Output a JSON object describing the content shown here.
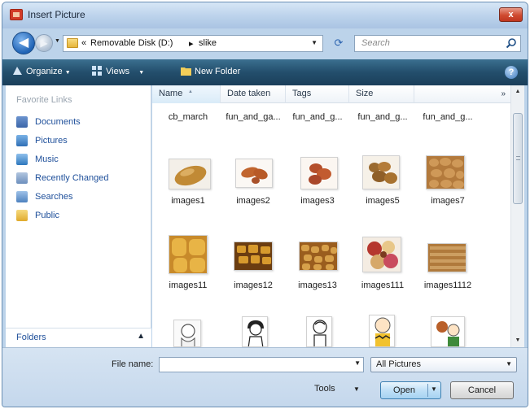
{
  "window": {
    "title": "Insert Picture",
    "close_label": "x"
  },
  "nav": {
    "back_glyph": "◀",
    "forward_glyph": "▶"
  },
  "address": {
    "prefix": "«",
    "crumbs": [
      "Removable Disk (D:)",
      "slike"
    ],
    "separator": "▸"
  },
  "search": {
    "placeholder": "Search"
  },
  "toolbar": {
    "organize": "Organize",
    "views": "Views",
    "new_folder": "New Folder",
    "help": "?"
  },
  "favorites": {
    "heading": "Favorite Links",
    "items": [
      {
        "label": "Documents",
        "icon": "documents-icon",
        "color": "#4b76b8"
      },
      {
        "label": "Pictures",
        "icon": "pictures-icon",
        "color": "#3f7fc4"
      },
      {
        "label": "Music",
        "icon": "music-icon",
        "color": "#3b86c8"
      },
      {
        "label": "Recently Changed",
        "icon": "recently-changed-icon",
        "color": "#6d8fbd"
      },
      {
        "label": "Searches",
        "icon": "searches-icon",
        "color": "#5e8fc6"
      },
      {
        "label": "Public",
        "icon": "public-icon",
        "color": "#e4b53a"
      }
    ]
  },
  "folders": {
    "label": "Folders",
    "chevron": "▲"
  },
  "columns": [
    {
      "label": "Name"
    },
    {
      "label": "Date taken"
    },
    {
      "label": "Tags"
    },
    {
      "label": "Size"
    }
  ],
  "columns_more": "»",
  "files": {
    "row0": [
      "cb_march",
      "fun_and_ga...",
      "fun_and_g...",
      "fun_and_g...",
      "fun_and_g..."
    ],
    "row1": [
      "images1",
      "images2",
      "images3",
      "images5",
      "images7"
    ],
    "row2": [
      "images11",
      "images12",
      "images13",
      "images111",
      "images1112"
    ]
  },
  "bottom": {
    "file_name_label": "File name:",
    "file_name_value": "",
    "file_type": "All Pictures",
    "tools": "Tools",
    "open": "Open",
    "cancel": "Cancel"
  },
  "colors": {
    "toolbar": "#234e6c",
    "accent_blue": "#1e4f9a",
    "close": "#cf4a30"
  }
}
